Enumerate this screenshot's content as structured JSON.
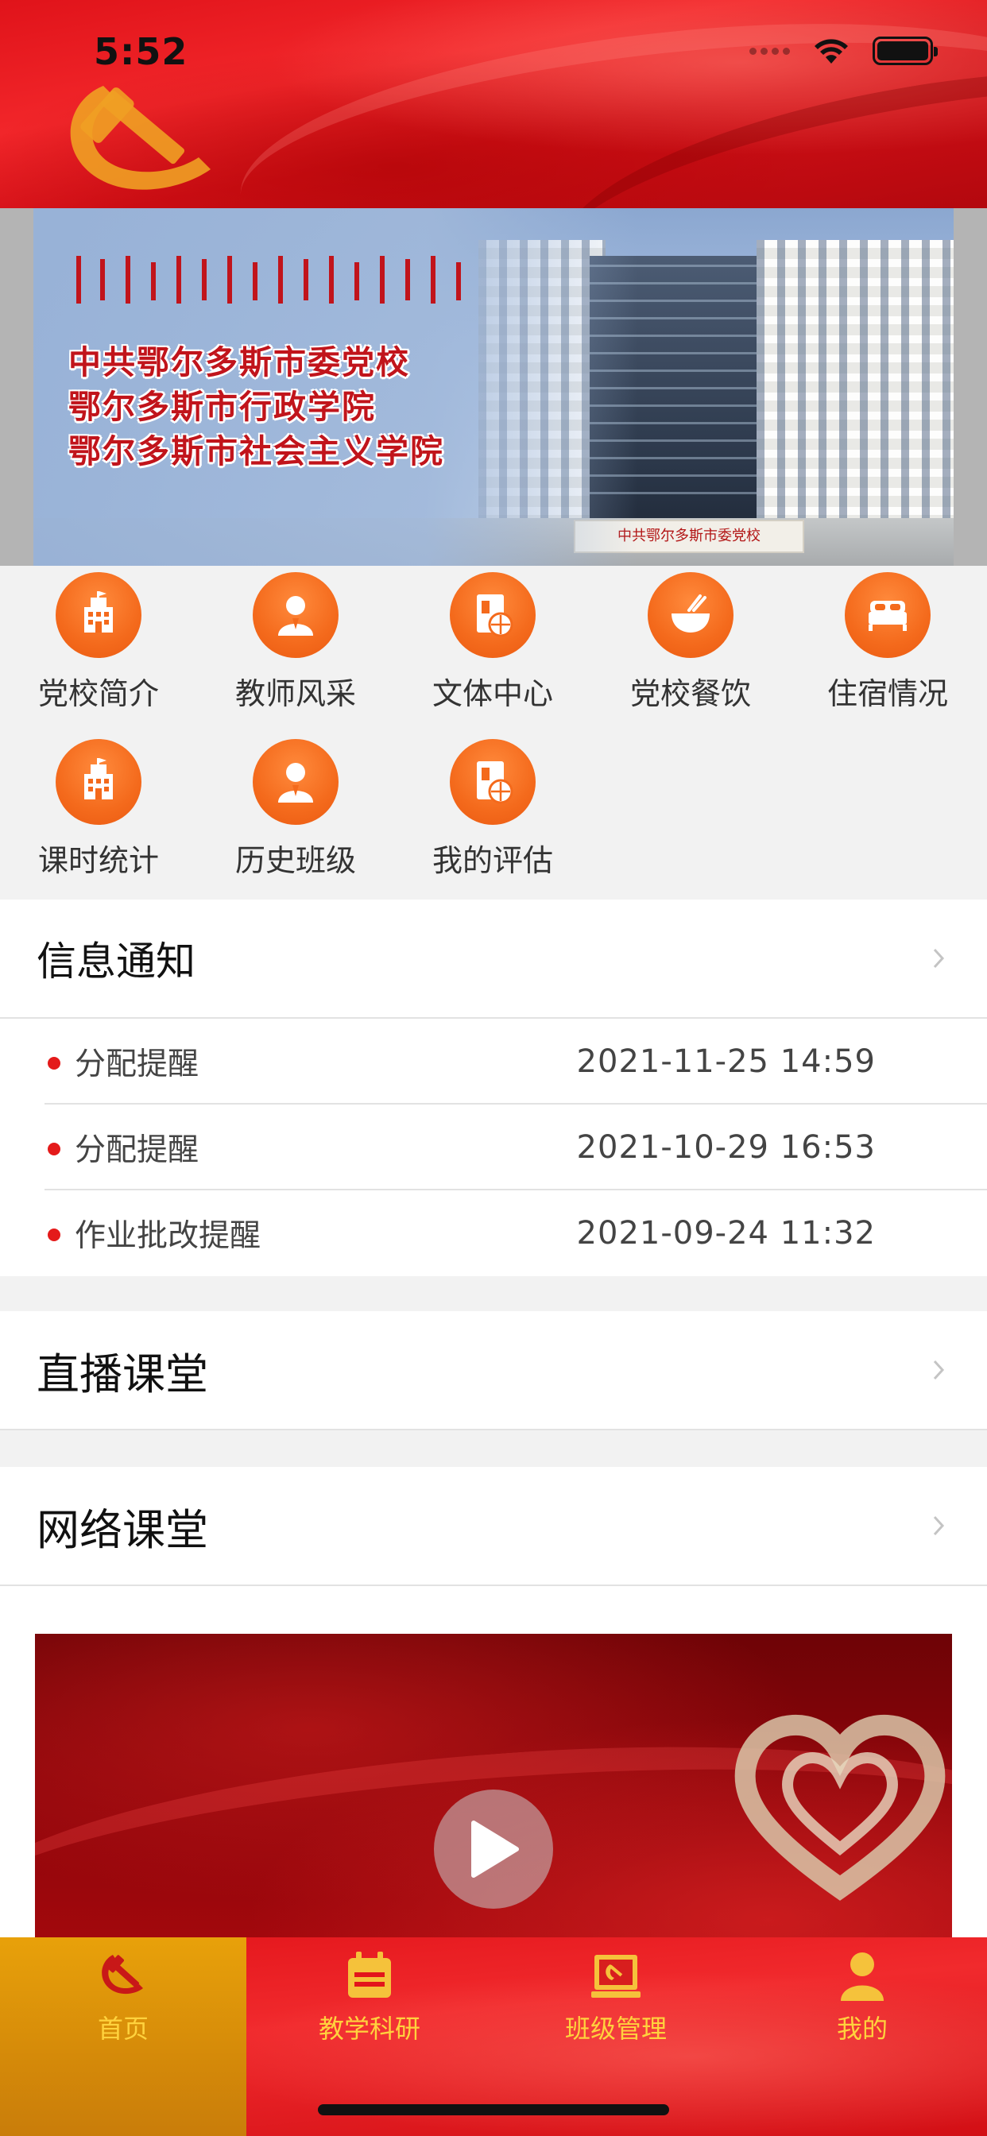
{
  "status_bar": {
    "time": "5:52"
  },
  "banner": {
    "lines": [
      "中共鄂尔多斯市委党校",
      "鄂尔多斯市行政学院",
      "鄂尔多斯市社会主义学院"
    ],
    "sign_text": "中共鄂尔多斯市委党校"
  },
  "menu": [
    {
      "label": "党校简介",
      "icon": "school-building-icon"
    },
    {
      "label": "教师风采",
      "icon": "teacher-person-icon"
    },
    {
      "label": "文体中心",
      "icon": "sports-book-icon"
    },
    {
      "label": "党校餐饮",
      "icon": "dining-bowl-icon"
    },
    {
      "label": "住宿情况",
      "icon": "bed-icon"
    },
    {
      "label": "课时统计",
      "icon": "school-building-icon"
    },
    {
      "label": "历史班级",
      "icon": "teacher-person-icon"
    },
    {
      "label": "我的评估",
      "icon": "sports-book-icon"
    }
  ],
  "notices": {
    "title": "信息通知",
    "items": [
      {
        "title": "分配提醒",
        "time": "2021-11-25 14:59"
      },
      {
        "title": "分配提醒",
        "time": "2021-10-29 16:53"
      },
      {
        "title": "作业批改提醒",
        "time": "2021-09-24 11:32"
      }
    ]
  },
  "live_class": {
    "title": "直播课堂"
  },
  "online_class": {
    "title": "网络课堂"
  },
  "tabbar": {
    "tabs": [
      {
        "label": "首页",
        "icon": "hammer-sickle-icon",
        "active": true
      },
      {
        "label": "教学科研",
        "icon": "calendar-icon",
        "active": false
      },
      {
        "label": "班级管理",
        "icon": "party-flag-icon",
        "active": false
      },
      {
        "label": "我的",
        "icon": "user-icon",
        "active": false
      }
    ]
  },
  "colors": {
    "brand_red": "#e3151b",
    "menu_orange": "#f46a1c",
    "tab_active_gold": "#d58a09",
    "tab_label_yellow": "#ffd23d",
    "notice_dot_red": "#e41a1a"
  }
}
